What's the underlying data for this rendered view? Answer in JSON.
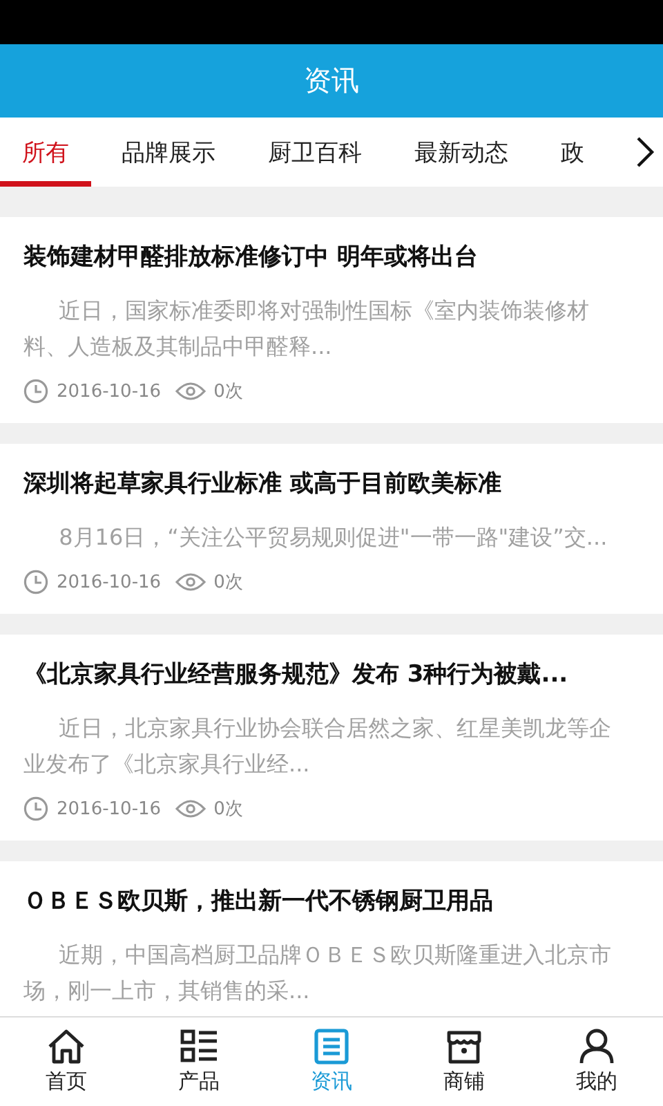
{
  "header": {
    "title": "资讯"
  },
  "tabs": [
    {
      "label": "所有",
      "selected": true
    },
    {
      "label": "品牌展示",
      "selected": false
    },
    {
      "label": "厨卫百科",
      "selected": false
    },
    {
      "label": "最新动态",
      "selected": false
    },
    {
      "label": "政",
      "selected": false
    }
  ],
  "articles": [
    {
      "title": "装饰建材甲醛排放标准修订中 明年或将出台",
      "summary": "近日，国家标准委即将对强制性国标《室内装饰装修材料、人造板及其制品中甲醛释...",
      "date": "2016-10-16",
      "views": "0次"
    },
    {
      "title": "深圳将起草家具行业标准 或高于目前欧美标准",
      "summary": "8月16日，“关注公平贸易规则促进\"一带一路\"建设”交...",
      "date": "2016-10-16",
      "views": "0次"
    },
    {
      "title": "《北京家具行业经营服务规范》发布 3种行为被戴...",
      "summary": "近日，北京家具行业协会联合居然之家、红星美凯龙等企业发布了《北京家具行业经...",
      "date": "2016-10-16",
      "views": "0次"
    },
    {
      "title": "ＯＢＥＳ欧贝斯，推出新一代不锈钢厨卫用品",
      "summary": "近期，中国高档厨卫品牌ＯＢＥＳ欧贝斯隆重进入北京市场，刚一上市，其销售的采..."
    }
  ],
  "bottom_nav": [
    {
      "label": "首页",
      "kind": "home",
      "selected": false
    },
    {
      "label": "产品",
      "kind": "list",
      "selected": false
    },
    {
      "label": "资讯",
      "kind": "news",
      "selected": true
    },
    {
      "label": "商铺",
      "kind": "shop",
      "selected": false
    },
    {
      "label": "我的",
      "kind": "user",
      "selected": false
    }
  ]
}
